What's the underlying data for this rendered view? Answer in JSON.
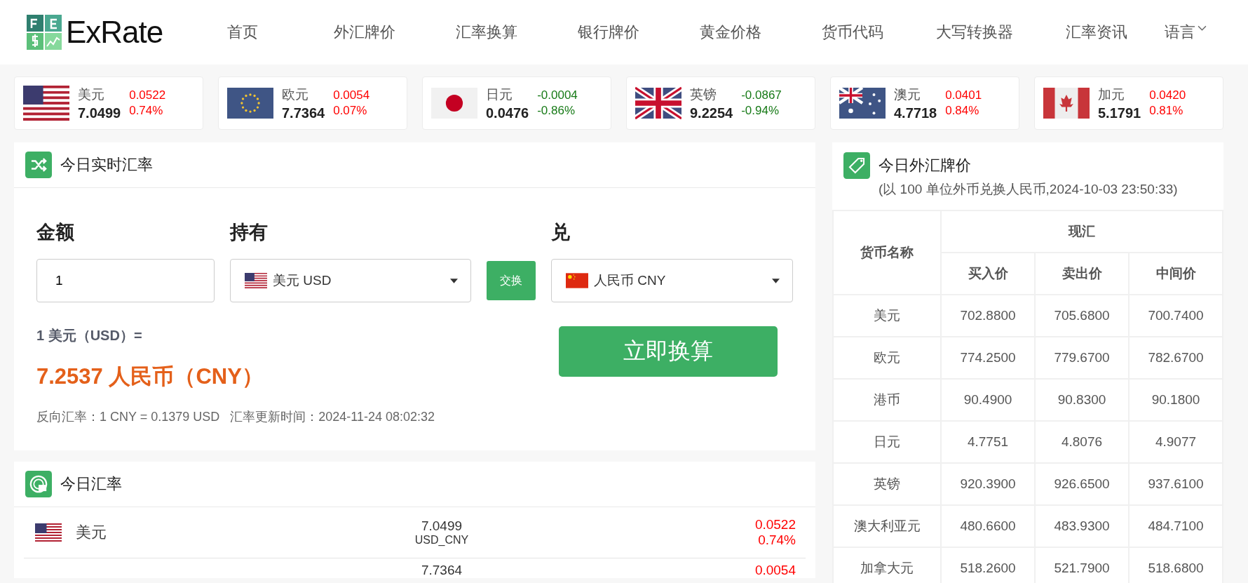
{
  "header": {
    "logo": "ExRate",
    "nav": [
      {
        "label": "首页",
        "kind": "link"
      },
      {
        "label": "外汇牌价",
        "kind": "link"
      },
      {
        "label": "汇率换算",
        "kind": "link"
      },
      {
        "label": "银行牌价",
        "kind": "link"
      },
      {
        "label": "黄金价格",
        "kind": "link"
      },
      {
        "label": "货币代码",
        "kind": "link"
      },
      {
        "label": "大写转换器",
        "kind": "link"
      },
      {
        "label": "汇率资讯",
        "kind": "link"
      },
      {
        "label": "语言",
        "kind": "dropdown"
      }
    ]
  },
  "tickers": [
    {
      "kind": "us",
      "name": "美元",
      "rate": "7.0499",
      "change": "0.0522",
      "percent": "0.74%",
      "rising": true
    },
    {
      "kind": "eu",
      "name": "欧元",
      "rate": "7.7364",
      "change": "0.0054",
      "percent": "0.07%",
      "rising": true
    },
    {
      "kind": "jp",
      "name": "日元",
      "rate": "0.0476",
      "change": "-0.0004",
      "percent": "-0.86%",
      "rising": false
    },
    {
      "kind": "gb",
      "name": "英镑",
      "rate": "9.2254",
      "change": "-0.0867",
      "percent": "-0.94%",
      "rising": false
    },
    {
      "kind": "au",
      "name": "澳元",
      "rate": "4.7718",
      "change": "0.0401",
      "percent": "0.84%",
      "rising": true
    },
    {
      "kind": "ca",
      "name": "加元",
      "rate": "5.1791",
      "change": "0.0420",
      "percent": "0.81%",
      "rising": true
    }
  ],
  "converter": {
    "title": "今日实时汇率",
    "amount_label": "金额",
    "amount_value": "1",
    "from_label": "持有",
    "from": {
      "kind": "us",
      "text": "美元 USD"
    },
    "swap_button": "交换",
    "to_label": "兑",
    "to": {
      "kind": "cn",
      "text": "人民币 CNY"
    },
    "equation": "1 美元（USD）=",
    "result": "7.2537 人民币（CNY）",
    "note": "反向汇率：1 CNY = 0.1379 USD   汇率更新时间：2024-11-24 08:02:32",
    "convert_button": "立即换算"
  },
  "today_rates": {
    "title": "今日汇率",
    "rows": [
      {
        "kind": "us",
        "name": "美元",
        "rate": "7.0499",
        "pair": "USD_CNY",
        "change": "0.0522",
        "percent": "0.74%",
        "rising": true
      },
      {
        "rate": "7.7364",
        "change": "0.0054",
        "rising": true
      }
    ]
  },
  "forex_board": {
    "title": "今日外汇牌价",
    "subtitle": "(以 100 单位外币兑换人民币,2024-10-03 23:50:33)",
    "name_header": "货币名称",
    "group_header": "现汇",
    "columns": [
      "买入价",
      "卖出价",
      "中间价"
    ],
    "rows": [
      {
        "name": "美元",
        "values": [
          "702.8800",
          "705.6800",
          "700.7400"
        ]
      },
      {
        "name": "欧元",
        "values": [
          "774.2500",
          "779.6700",
          "782.6700"
        ]
      },
      {
        "name": "港币",
        "values": [
          "90.4900",
          "90.8300",
          "90.1800"
        ]
      },
      {
        "name": "日元",
        "values": [
          "4.7751",
          "4.8076",
          "4.9077"
        ]
      },
      {
        "name": "英镑",
        "values": [
          "920.3900",
          "926.6500",
          "937.6100"
        ]
      },
      {
        "name": "澳大利亚元",
        "values": [
          "480.6600",
          "483.9300",
          "484.7100"
        ]
      },
      {
        "name": "加拿大元",
        "values": [
          "518.2600",
          "521.7900",
          "518.6800"
        ]
      }
    ]
  }
}
